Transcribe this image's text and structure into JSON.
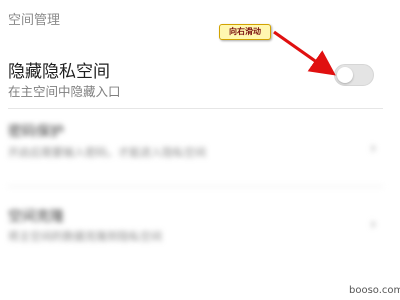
{
  "section_header": "空间管理",
  "hidden_space": {
    "title": "隐藏隐私空间",
    "subtitle": "在主空间中隐藏入口",
    "toggle_on": false
  },
  "blurred_rows": [
    {
      "title": "密码保护",
      "subtitle": "开启后需要输入密码，才能进入隐私空间"
    },
    {
      "title": "空间克隆",
      "subtitle": "将主空间的数据克隆到隐私空间"
    }
  ],
  "annotation": {
    "label": "向右滑动",
    "arrow_color": "#e01010"
  },
  "watermark": "booso.com"
}
